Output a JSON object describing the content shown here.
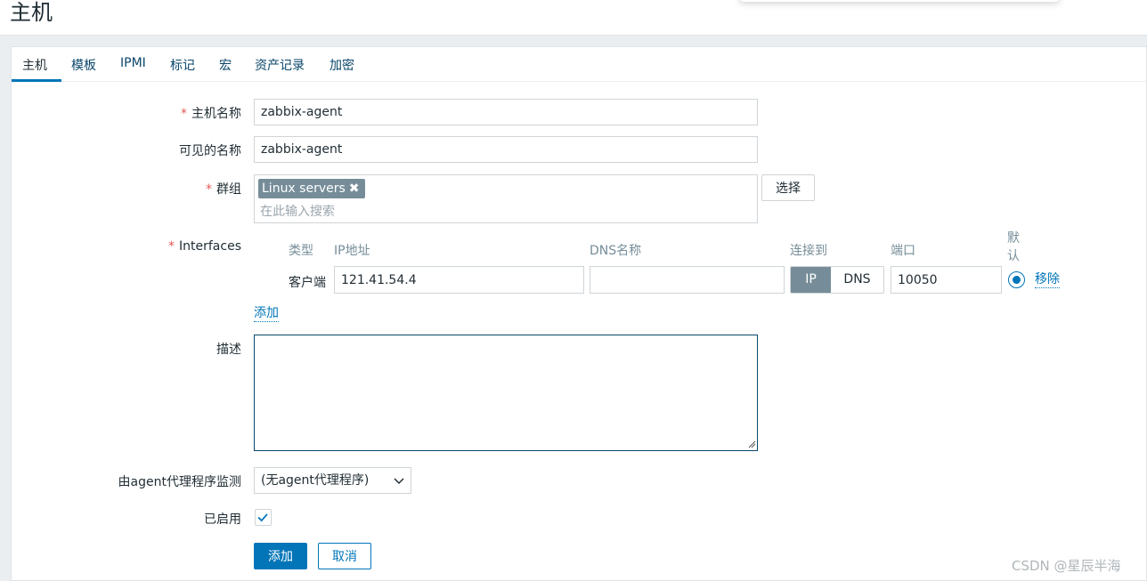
{
  "page": {
    "title": "主机"
  },
  "tabs": [
    {
      "label": "主机"
    },
    {
      "label": "模板"
    },
    {
      "label": "IPMI"
    },
    {
      "label": "标记"
    },
    {
      "label": "宏"
    },
    {
      "label": "资产记录"
    },
    {
      "label": "加密"
    }
  ],
  "form": {
    "host_name": {
      "label": "主机名称",
      "value": "zabbix-agent",
      "required": true
    },
    "visible_name": {
      "label": "可见的名称",
      "value": "zabbix-agent"
    },
    "groups": {
      "label": "群组",
      "required": true,
      "selected": [
        "Linux servers"
      ],
      "placeholder": "在此输入搜索",
      "select_button": "选择"
    },
    "interfaces": {
      "label": "Interfaces",
      "required": true,
      "headers": {
        "type": "类型",
        "ip": "IP地址",
        "dns": "DNS名称",
        "connect": "连接到",
        "port": "端口",
        "default": "默认"
      },
      "rows": [
        {
          "type": "客户端",
          "ip": "121.41.54.4",
          "dns": "",
          "connect_options": [
            "IP",
            "DNS"
          ],
          "connect_selected": "IP",
          "port": "10050",
          "default": true,
          "remove_label": "移除"
        }
      ],
      "add_label": "添加"
    },
    "description": {
      "label": "描述",
      "value": ""
    },
    "proxy": {
      "label": "由agent代理程序监测",
      "value": "(无agent代理程序)"
    },
    "enabled": {
      "label": "已启用",
      "checked": true
    },
    "buttons": {
      "add": "添加",
      "cancel": "取消"
    }
  },
  "watermark": "CSDN @星辰半海",
  "colors": {
    "accent": "#0275b8",
    "required": "#e45959",
    "tag_bg": "#768d99"
  }
}
